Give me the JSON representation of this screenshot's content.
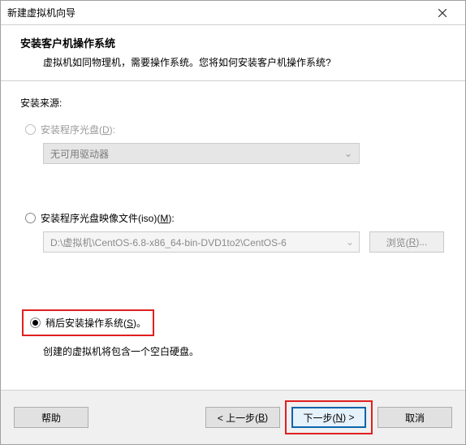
{
  "title": "新建虚拟机向导",
  "header": {
    "title": "安装客户机操作系统",
    "desc": "虚拟机如同物理机，需要操作系统。您将如何安装客户机操作系统?"
  },
  "source_label": "安装来源:",
  "opt_disc": {
    "label_before": "安装程序光盘(",
    "hk": "D",
    "label_after": "):"
  },
  "disc_dropdown": "无可用驱动器",
  "opt_iso": {
    "label_before": "安装程序光盘映像文件(iso)(",
    "hk": "M",
    "label_after": "):"
  },
  "iso_path": "D:\\虚拟机\\CentOS-6.8-x86_64-bin-DVD1to2\\CentOS-6",
  "browse": {
    "before": "浏览(",
    "hk": "R",
    "after": ")..."
  },
  "opt_later": {
    "label_before": "稍后安装操作系统(",
    "hk": "S",
    "label_after": ")。"
  },
  "later_desc": "创建的虚拟机将包含一个空白硬盘。",
  "buttons": {
    "help": "帮助",
    "back": {
      "before": "< 上一步(",
      "hk": "B",
      "after": ")"
    },
    "next": {
      "before": "下一步(",
      "hk": "N",
      "after": ") >"
    },
    "cancel": "取消"
  }
}
